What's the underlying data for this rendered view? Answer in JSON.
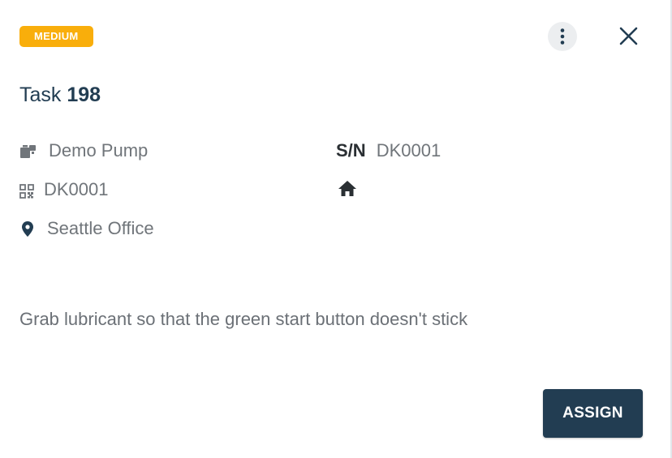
{
  "priority": {
    "label": "MEDIUM",
    "color": "#f9ae0b"
  },
  "header": {
    "more_icon": "vertical-dots-icon",
    "close_icon": "close-icon"
  },
  "task": {
    "prefix": "Task",
    "number": "198"
  },
  "details": {
    "asset": {
      "icon": "asset-icon",
      "value": "Demo Pump"
    },
    "serial": {
      "label": "S/N",
      "value": "DK0001"
    },
    "code": {
      "icon": "qr-code-icon",
      "value": "DK0001"
    },
    "home": {
      "icon": "home-icon"
    },
    "location": {
      "icon": "location-pin-icon",
      "value": "Seattle Office"
    }
  },
  "description": "Grab lubricant so that the green start button doesn't stick",
  "actions": {
    "assign_label": "ASSIGN"
  },
  "colors": {
    "primary": "#223d52",
    "muted_text": "#70757a"
  }
}
